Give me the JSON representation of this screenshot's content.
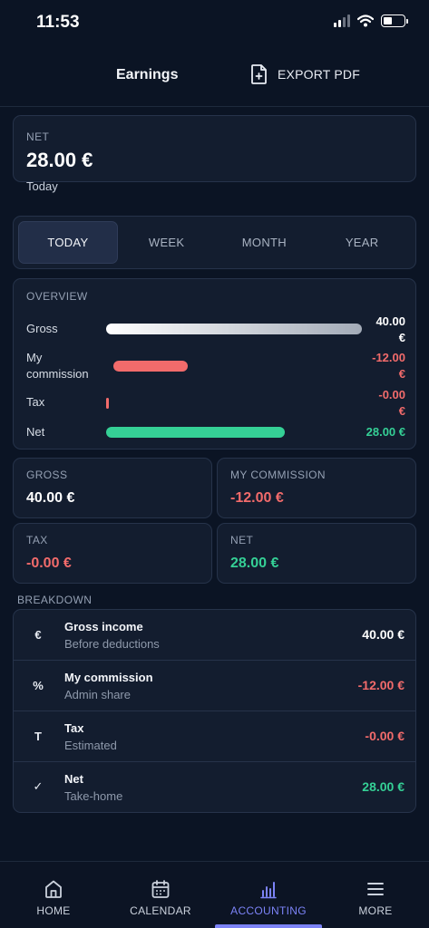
{
  "status_bar": {
    "time": "11:53",
    "icons": [
      "signal-icon",
      "wifi-icon",
      "battery-icon"
    ]
  },
  "header": {
    "title": "Earnings",
    "export_label": "EXPORT PDF",
    "export_icon": "file-plus-icon"
  },
  "net_card": {
    "label": "NET",
    "value": "28.00 €",
    "period": "Today"
  },
  "tabs": [
    {
      "label": "TODAY",
      "active": true
    },
    {
      "label": "WEEK",
      "active": false
    },
    {
      "label": "MONTH",
      "active": false
    },
    {
      "label": "YEAR",
      "active": false
    }
  ],
  "overview": {
    "title": "OVERVIEW",
    "rows": [
      {
        "label": "Gross",
        "value_line1": "40.00",
        "value_line2": "€",
        "fill": 1.0,
        "color": "gradient-white"
      },
      {
        "label_line1": "My",
        "label_line2": "commission",
        "value_line1": "-12.00",
        "value_line2": "€",
        "fill": 0.3,
        "color": "#f26b6b"
      },
      {
        "label": "Tax",
        "value_line1": "-0.00",
        "value_line2": "€",
        "fill": 0.0,
        "color": "#f26b6b"
      },
      {
        "label": "Net",
        "value": "28.00 €",
        "fill": 0.7,
        "color": "#35d096"
      }
    ]
  },
  "summary": {
    "gross": {
      "label": "GROSS",
      "value": "40.00 €"
    },
    "commission": {
      "label": "MY COMMISSION",
      "value": "-12.00 €"
    },
    "tax": {
      "label": "TAX",
      "value": "-0.00 €"
    },
    "net": {
      "label": "NET",
      "value": "28.00 €"
    }
  },
  "breakdown": {
    "title": "BREAKDOWN",
    "rows": [
      {
        "icon": "€",
        "title": "Gross income",
        "subtitle": "Before deductions",
        "value": "40.00 €"
      },
      {
        "icon": "%",
        "title": "My commission",
        "subtitle": "Admin share",
        "value": "-12.00 €"
      },
      {
        "icon": "T",
        "title": "Tax",
        "subtitle": "Estimated",
        "value": "-0.00 €"
      },
      {
        "icon": "✓",
        "title": "Net",
        "subtitle": "Take-home",
        "value": "28.00 €"
      }
    ]
  },
  "colors": {
    "positive": "#35d096",
    "negative": "#f26b6b",
    "accent": "#7c83f7",
    "neutral": "#ffffff"
  },
  "nav": [
    {
      "label": "HOME",
      "icon": "home-icon",
      "active": false
    },
    {
      "label": "CALENDAR",
      "icon": "calendar-icon",
      "active": false
    },
    {
      "label": "ACCOUNTING",
      "icon": "bar-chart-icon",
      "active": true
    },
    {
      "label": "MORE",
      "icon": "menu-icon",
      "active": false
    }
  ]
}
